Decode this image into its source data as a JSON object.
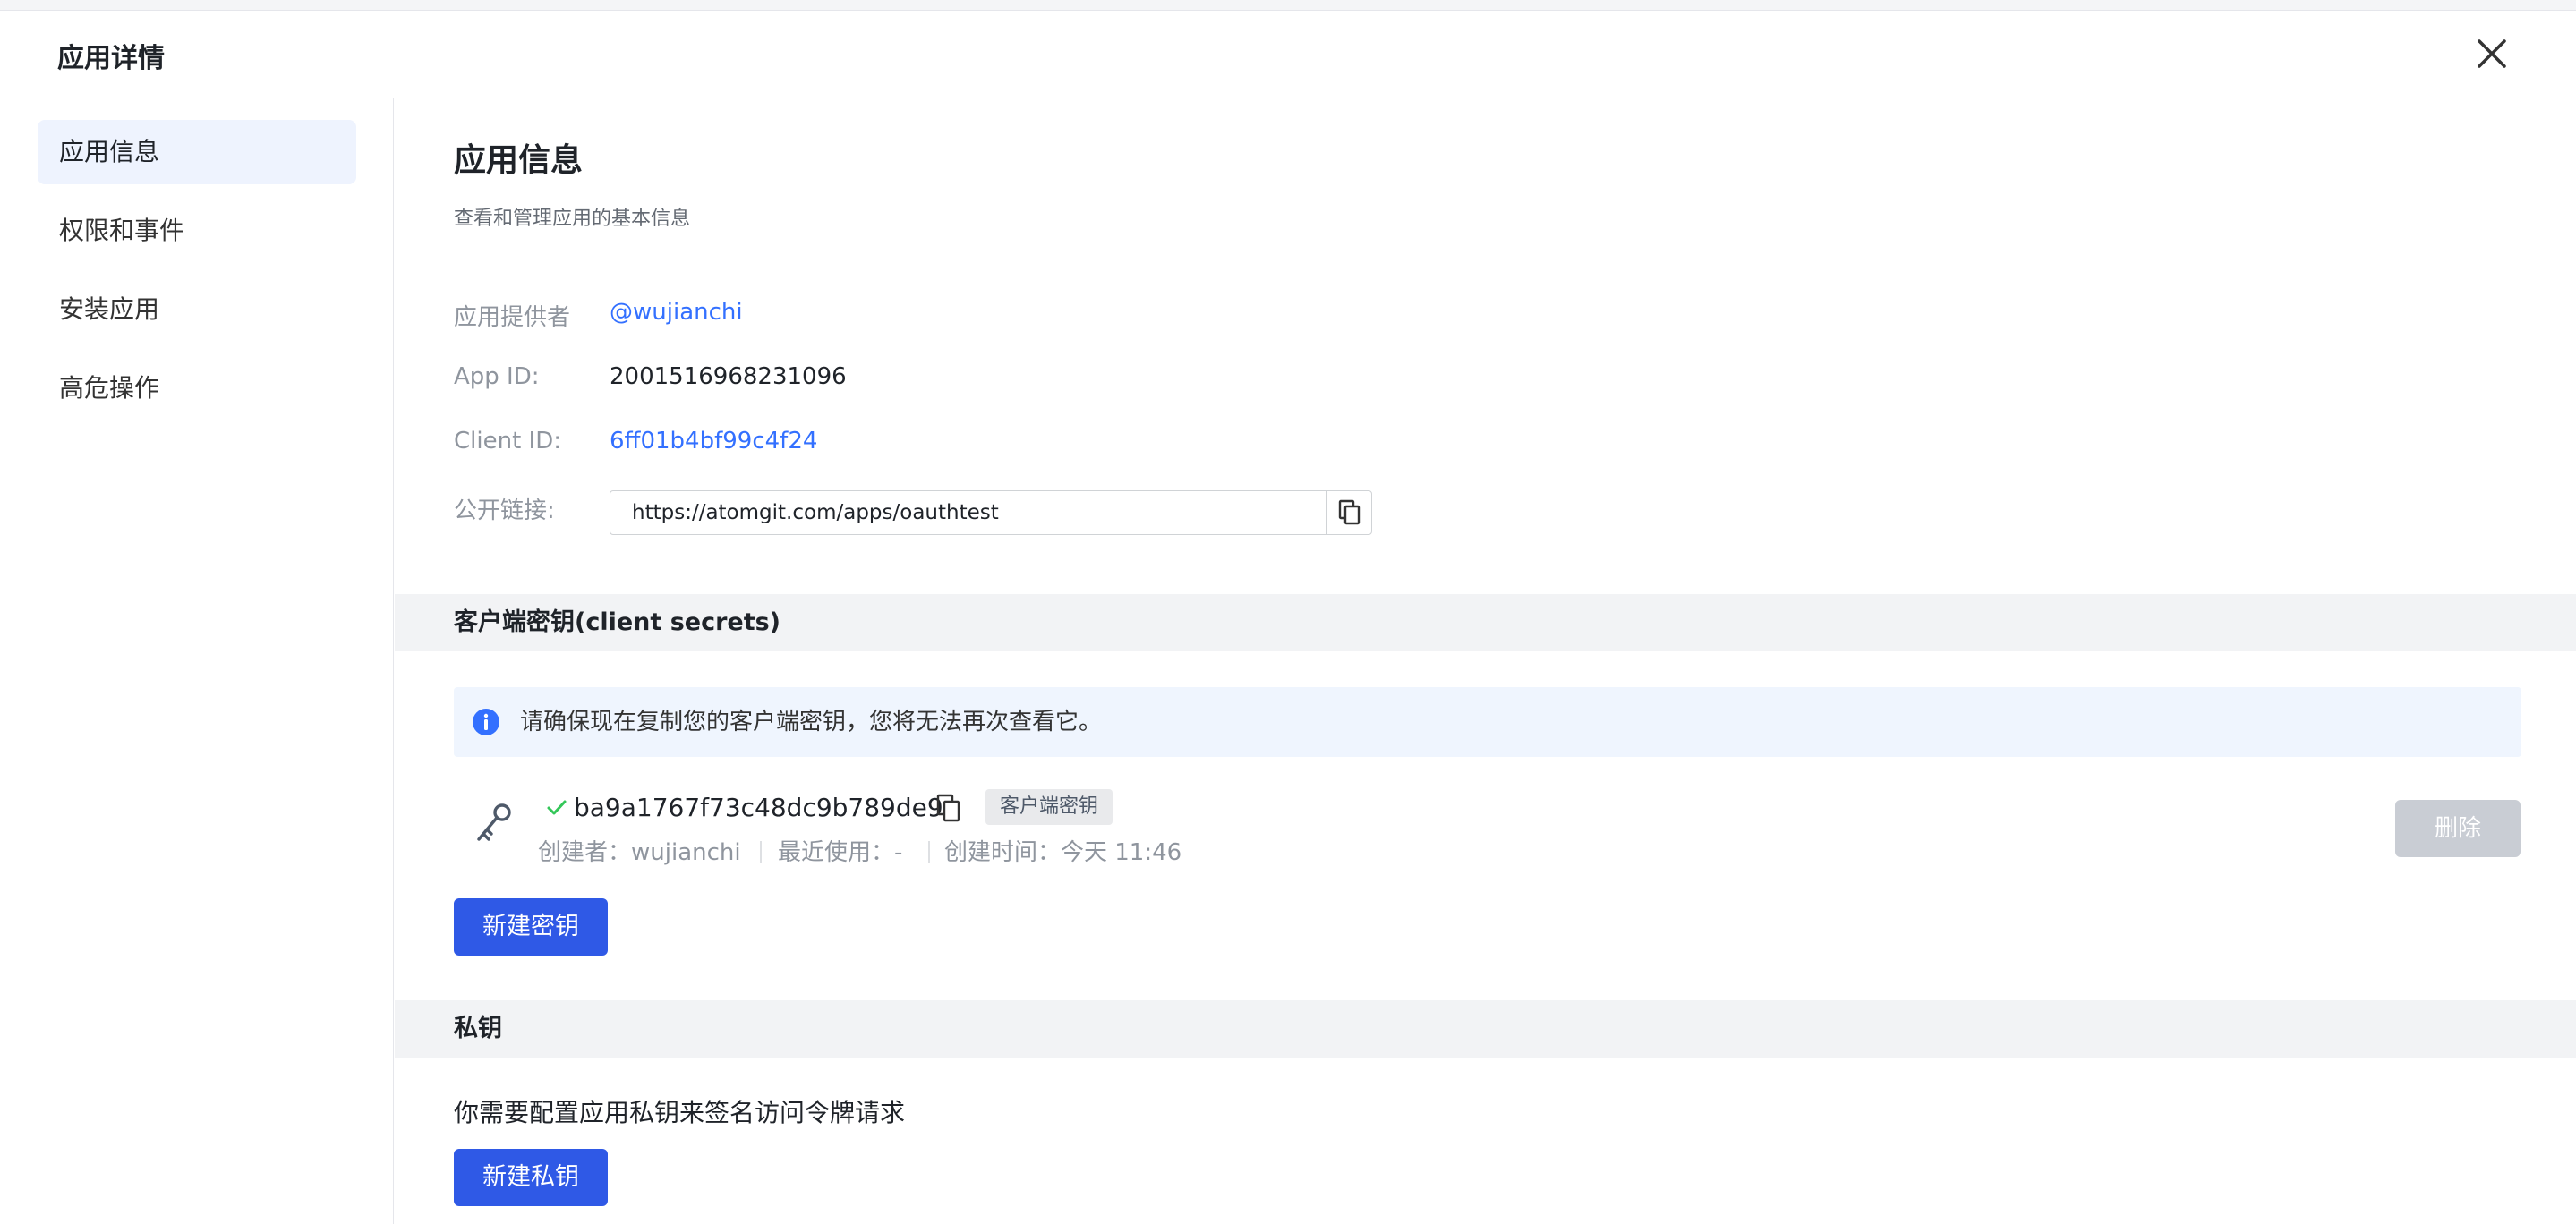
{
  "header": {
    "title": "应用详情"
  },
  "sidebar": {
    "items": [
      {
        "label": "应用信息",
        "active": true
      },
      {
        "label": "权限和事件",
        "active": false
      },
      {
        "label": "安装应用",
        "active": false
      },
      {
        "label": "高危操作",
        "active": false
      }
    ]
  },
  "main": {
    "title": "应用信息",
    "subtitle": "查看和管理应用的基本信息",
    "info": {
      "provider_label": "应用提供者",
      "provider_value": "@wujianchi",
      "appid_label": "App ID:",
      "appid_value": "2001516968231096",
      "clientid_label": "Client ID:",
      "clientid_value": "6ff01b4bf99c4f24",
      "link_label": "公开链接:",
      "link_value": "https://atomgit.com/apps/oauthtest"
    },
    "secrets": {
      "section_title": "客户端密钥(client secrets)",
      "notice": "请确保现在复制您的客户端密钥，您将无法再次查看它。",
      "secret_value": "ba9a1767f73c48dc9b789de9",
      "tag": "客户端密钥",
      "creator": "创建者：wujianchi",
      "last_used": "最近使用：-",
      "created_time": "创建时间：今天 11:46",
      "delete_label": "删除",
      "new_button": "新建密钥"
    },
    "private_key": {
      "section_title": "私钥",
      "description": "你需要配置应用私钥来签名访问令牌请求",
      "new_button": "新建私钥"
    }
  },
  "colors": {
    "primary": "#2f59e6",
    "link": "#3370ff",
    "success": "#34c759",
    "disabled": "#c9cdd4",
    "active_bg": "#eef3fe"
  },
  "icons": [
    "close-icon",
    "copy-icon",
    "info-icon",
    "key-icon",
    "check-icon"
  ]
}
